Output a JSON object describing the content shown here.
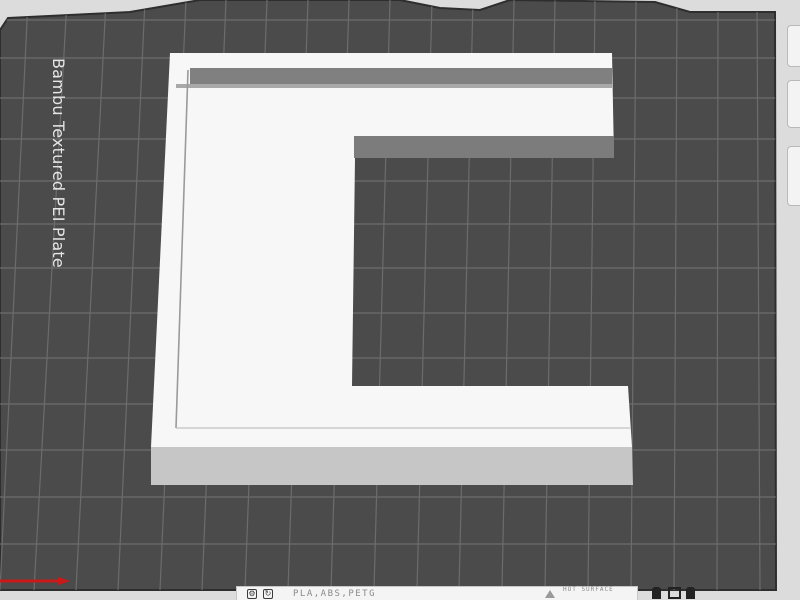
{
  "plate": {
    "label": "Bambu Textured PEI Plate",
    "bed_color": "#4b4b4b",
    "grid_color": "#6c6c6c",
    "model_color": "#f5f5f5"
  },
  "toolbar_bottom": {
    "filament_text": "PLA,ABS,PETG",
    "hot_surface_text": "HOT SURFACE"
  },
  "icons": [
    "plate-settings-icon",
    "auto-orient-icon",
    "hot-surface-warning-icon",
    "arrange-icon",
    "layers-icon",
    "delete-icon"
  ]
}
